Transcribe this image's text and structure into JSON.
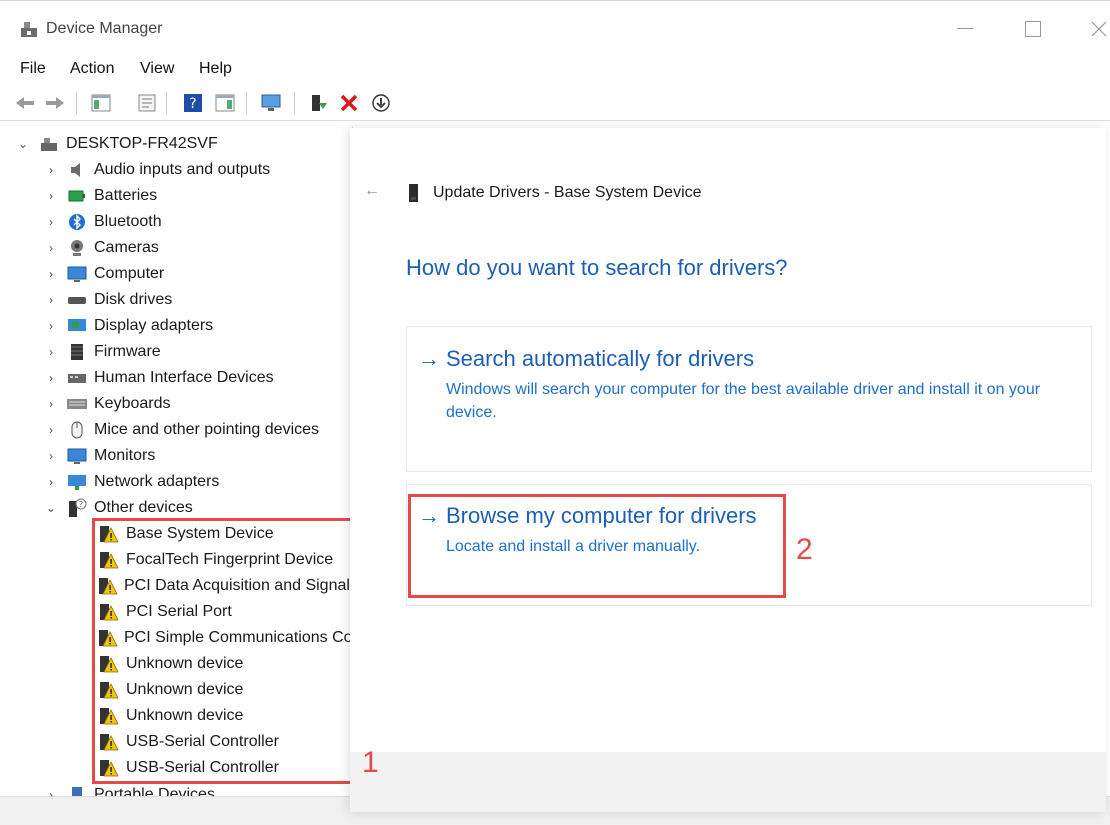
{
  "window": {
    "title": "Device Manager"
  },
  "menu": [
    "File",
    "Action",
    "View",
    "Help"
  ],
  "tree": {
    "root": "DESKTOP-FR42SVF",
    "categories": [
      {
        "label": "Audio inputs and outputs",
        "icon": "speaker-icon"
      },
      {
        "label": "Batteries",
        "icon": "battery-icon"
      },
      {
        "label": "Bluetooth",
        "icon": "bluetooth-icon"
      },
      {
        "label": "Cameras",
        "icon": "camera-icon"
      },
      {
        "label": "Computer",
        "icon": "computer-icon"
      },
      {
        "label": "Disk drives",
        "icon": "disk-drive-icon"
      },
      {
        "label": "Display adapters",
        "icon": "display-adapter-icon"
      },
      {
        "label": "Firmware",
        "icon": "firmware-icon"
      },
      {
        "label": "Human Interface Devices",
        "icon": "hid-icon"
      },
      {
        "label": "Keyboards",
        "icon": "keyboard-icon"
      },
      {
        "label": "Mice and other pointing devices",
        "icon": "mouse-icon"
      },
      {
        "label": "Monitors",
        "icon": "monitor-icon"
      },
      {
        "label": "Network adapters",
        "icon": "network-adapter-icon"
      },
      {
        "label": "Other devices",
        "icon": "unknown-device-icon"
      }
    ],
    "other_devices": [
      "Base System Device",
      "FocalTech Fingerprint Device",
      "PCI Data Acquisition and Signal Processing Controller",
      "PCI Serial Port",
      "PCI Simple Communications Controller",
      "Unknown device",
      "Unknown device",
      "Unknown device",
      "USB-Serial Controller",
      "USB-Serial Controller"
    ],
    "after_other": "Portable Devices"
  },
  "wizard": {
    "header": "Update Drivers - Base System Device",
    "question": "How do you want to search for drivers?",
    "options": [
      {
        "title": "Search automatically for drivers",
        "desc": "Windows will search your computer for the best available driver and install it on your device."
      },
      {
        "title": "Browse my computer for drivers",
        "desc": "Locate and install a driver manually."
      }
    ],
    "arrow_glyph": "→",
    "back_glyph": "←"
  },
  "annotations": [
    "1",
    "2"
  ],
  "colors": {
    "link_blue": "#1d5fb3",
    "annotation_red": "#e34a4a",
    "warning_yellow": "#f2c40f"
  }
}
